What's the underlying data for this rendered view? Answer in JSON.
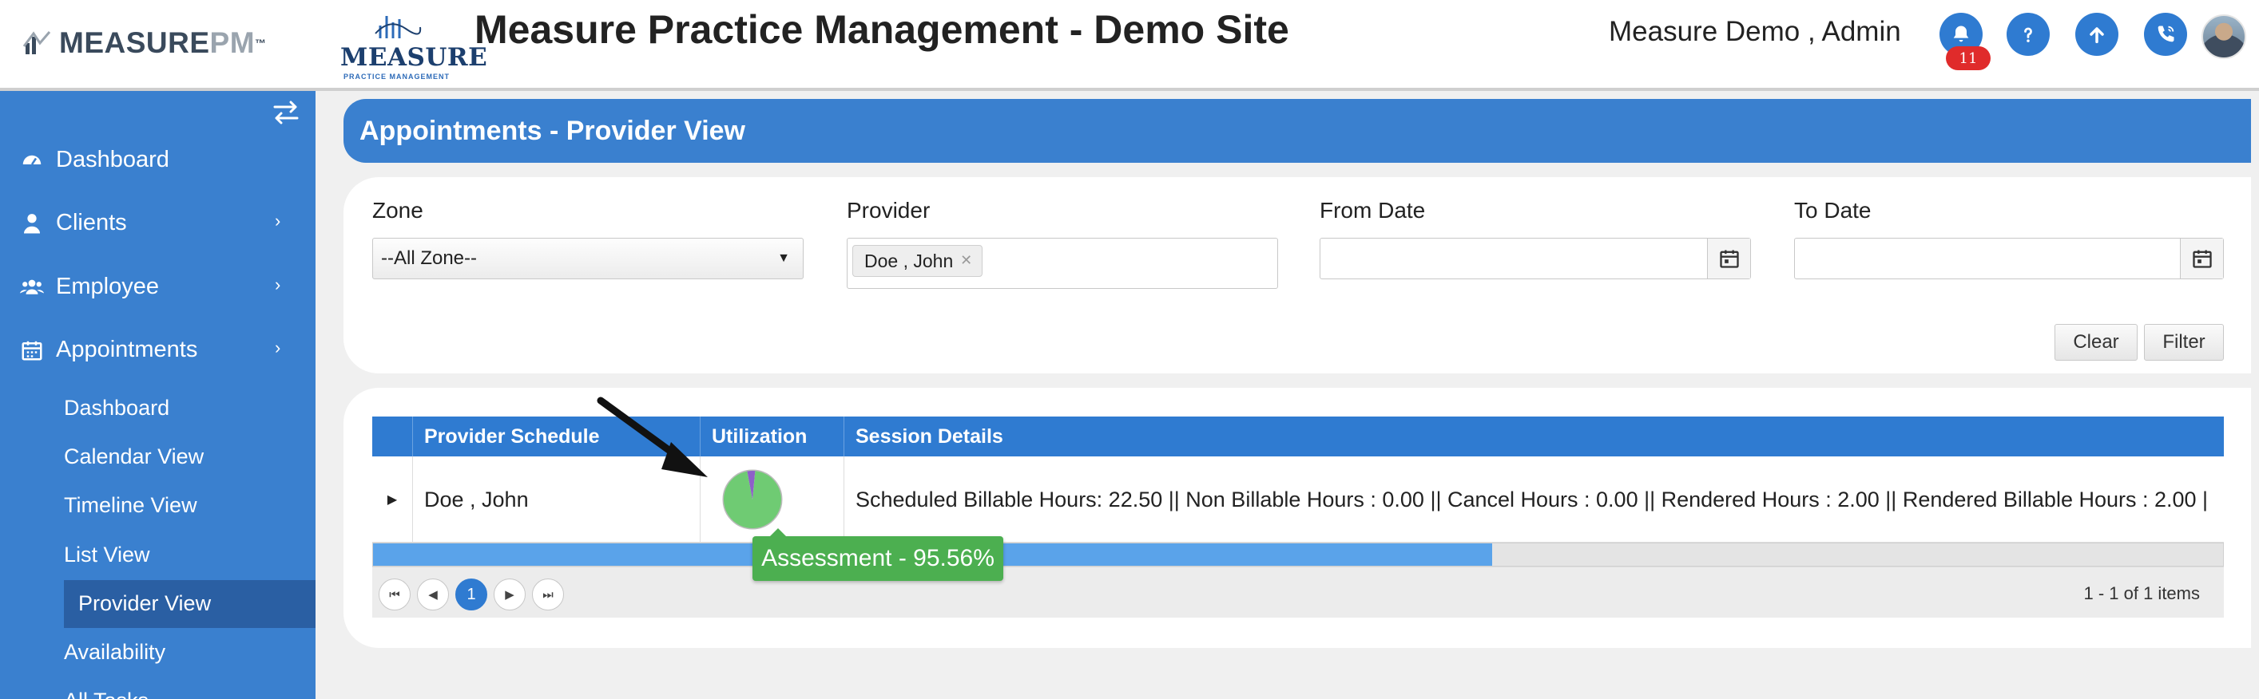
{
  "header": {
    "brand_a": "MEASURE",
    "brand_b": "PM",
    "brand_tm": "™",
    "logo2_word": "MEASURE",
    "logo2_tag": "PRACTICE MANAGEMENT",
    "site_title": "Measure Practice Management - Demo Site",
    "user_name": "Measure Demo , Admin",
    "notification_count": "11",
    "icons": [
      "bell-icon",
      "help-icon",
      "upload-icon",
      "phone-icon"
    ]
  },
  "sidebar": {
    "main_items": [
      {
        "label": "Dashboard",
        "icon": "dashboard-icon"
      },
      {
        "label": "Clients",
        "icon": "user-icon"
      },
      {
        "label": "Employee",
        "icon": "users-icon"
      },
      {
        "label": "Appointments",
        "icon": "calendar-icon"
      }
    ],
    "sub_items": [
      "Dashboard",
      "Calendar View",
      "Timeline View",
      "List View",
      "Provider View",
      "Availability",
      "All Tasks"
    ],
    "active_sub": "Provider View"
  },
  "page": {
    "title": "Appointments - Provider View"
  },
  "filters": {
    "zone_label": "Zone",
    "zone_value": "--All Zone--",
    "provider_label": "Provider",
    "provider_chip": "Doe , John",
    "from_label": "From Date",
    "from_value": "",
    "to_label": "To Date",
    "to_value": "",
    "clear_label": "Clear",
    "filter_label": "Filter"
  },
  "grid": {
    "columns": [
      "Provider Schedule",
      "Utilization",
      "Session Details"
    ],
    "rows": [
      {
        "provider": "Doe , John",
        "utilization_assessment_pct": 95.56,
        "session_details": "Scheduled Billable Hours: 22.50 || Non Billable Hours : 0.00 || Cancel Hours : 0.00 || Rendered Hours : 2.00 || Rendered Billable Hours : 2.00 |"
      }
    ],
    "tooltip": "Assessment - 95.56%",
    "scroll_position": 0.55,
    "pager": {
      "current_page": "1",
      "info": "1 - 1 of 1 items"
    }
  },
  "colors": {
    "primary": "#3a80cf",
    "header_blue": "#2f7bd1",
    "sidebar_active": "#2a5fa3",
    "pie_green": "#6fcb73",
    "pie_purple": "#8e5fc9",
    "badge_red": "#e02b2b"
  }
}
